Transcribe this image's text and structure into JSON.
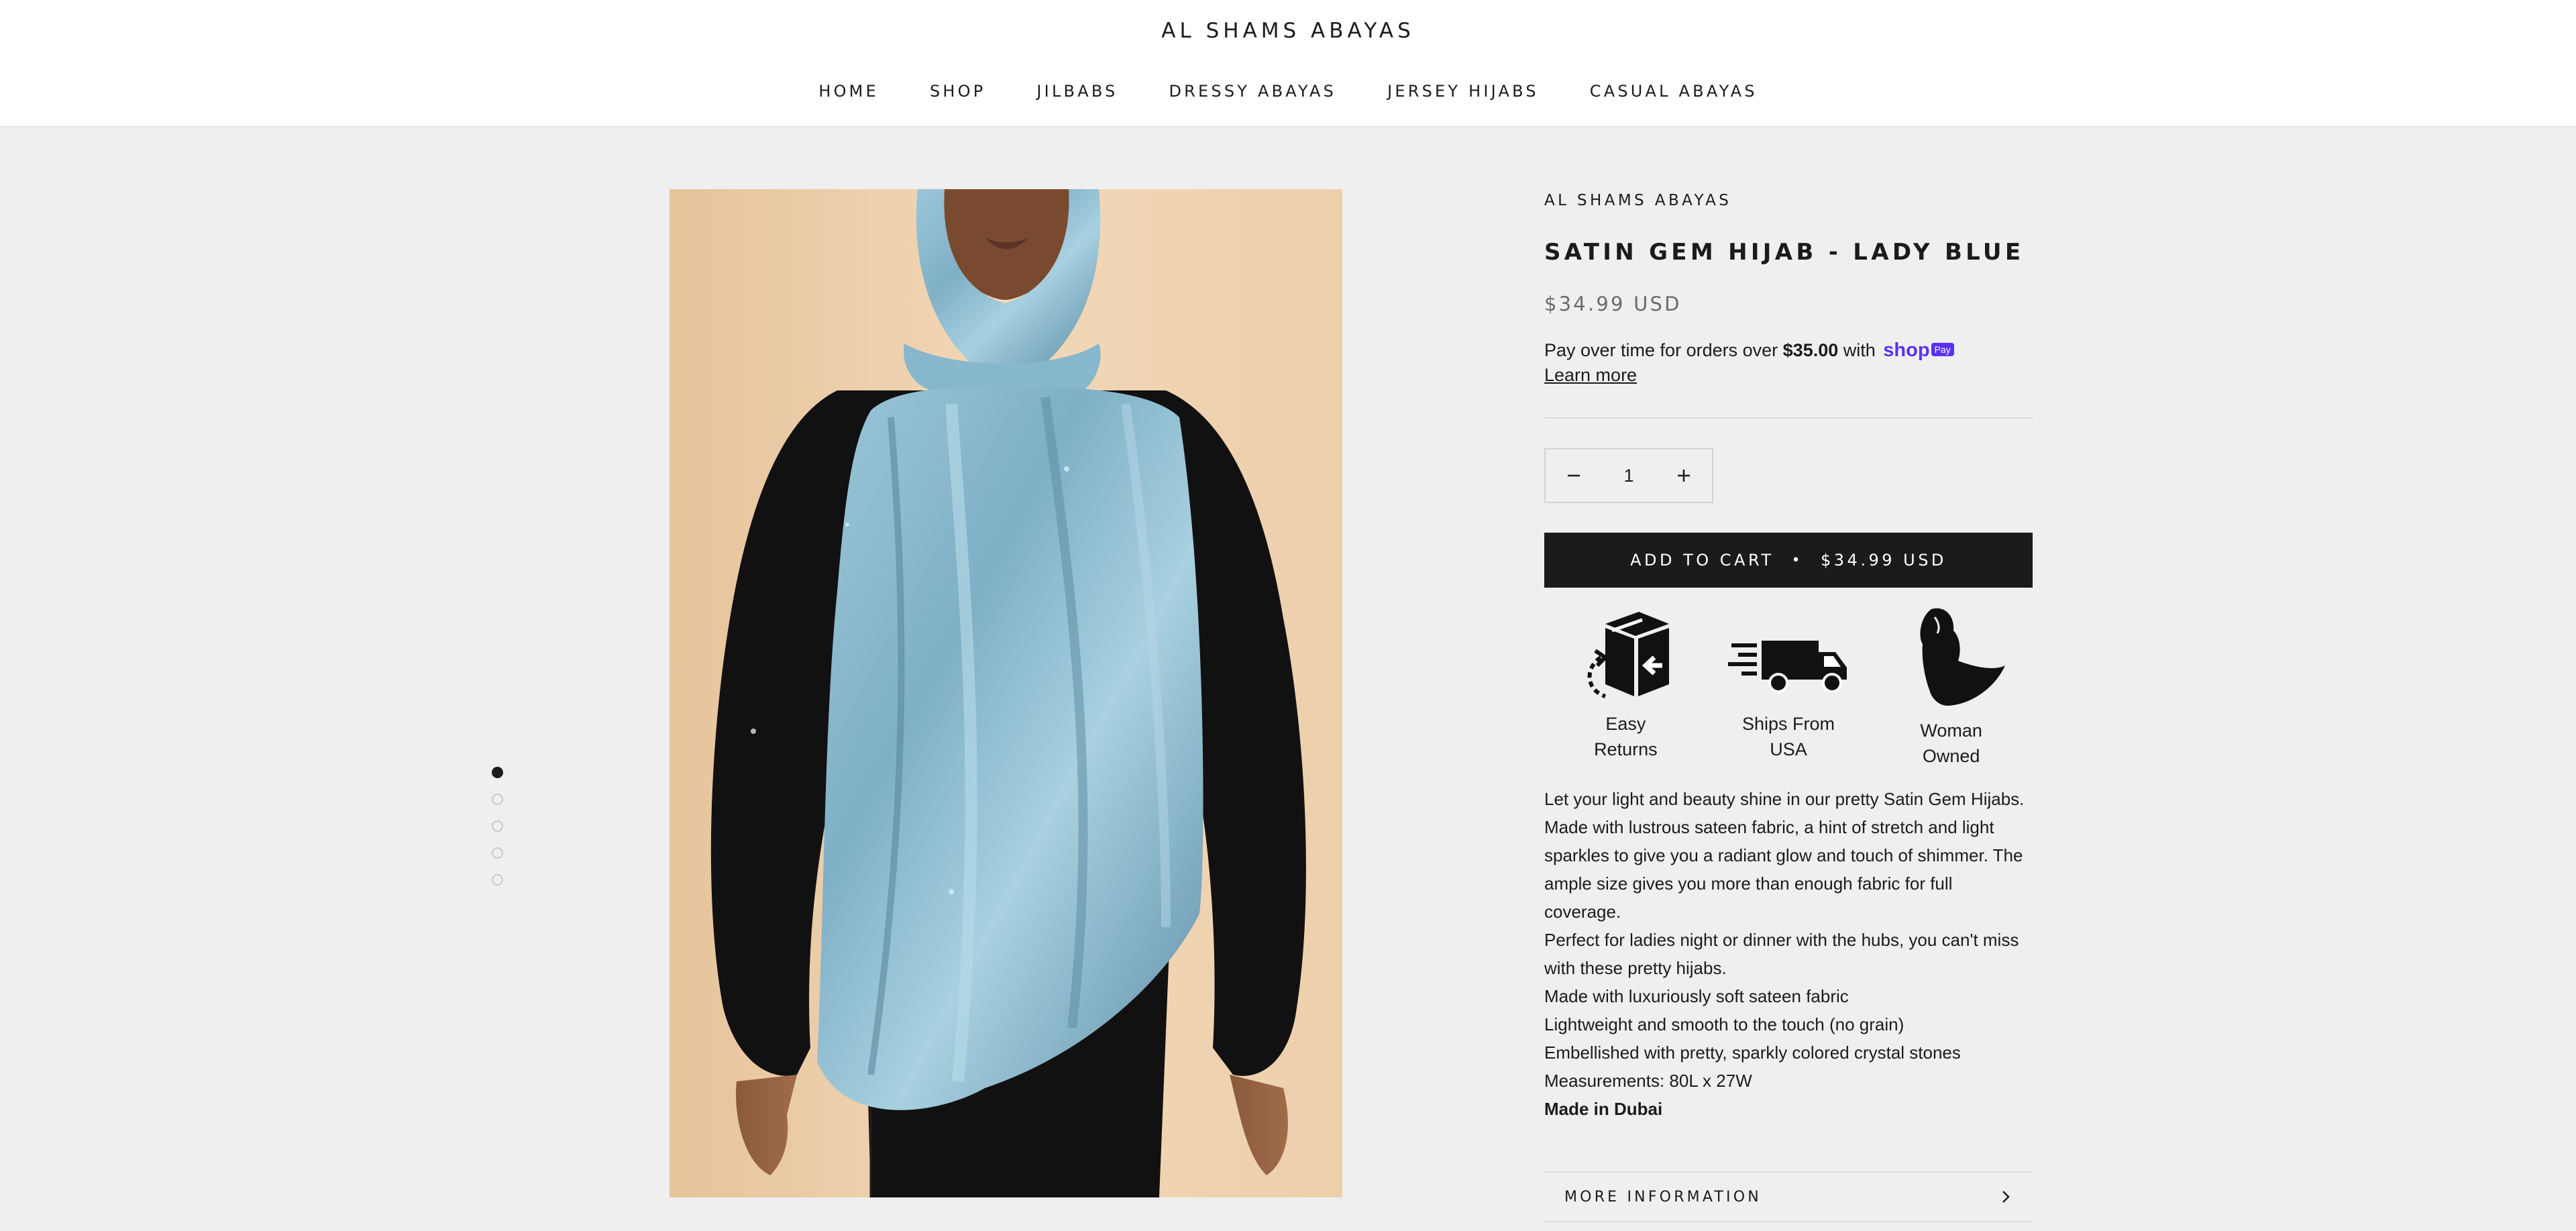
{
  "header": {
    "logo": "AL SHAMS ABAYAS",
    "nav": [
      "HOME",
      "SHOP",
      "JILBABS",
      "DRESSY ABAYAS",
      "JERSEY HIJABS",
      "CASUAL ABAYAS"
    ]
  },
  "gallery": {
    "slide_count": 5,
    "active_slide": 1,
    "image_icon": "product-photo-hijab"
  },
  "product": {
    "vendor": "AL SHAMS ABAYAS",
    "title": "SATIN GEM HIJAB - LADY BLUE",
    "price": "$34.99 USD",
    "shoppay": {
      "prefix": "Pay over time for orders over",
      "amount": "$35.00",
      "suffix": "with",
      "brand": "shop",
      "badge": "Pay",
      "learn_more": "Learn more"
    },
    "quantity": {
      "value": "1",
      "minus_icon": "minus-icon",
      "plus_icon": "plus-icon"
    },
    "add_to_cart": {
      "label": "ADD TO CART",
      "separator": "•",
      "price": "$34.99 USD"
    },
    "badges": [
      {
        "icon": "box-return-icon",
        "line1": "Easy",
        "line2": "Returns"
      },
      {
        "icon": "delivery-truck-icon",
        "line1": "Ships From",
        "line2": "USA"
      },
      {
        "icon": "woman-hijab-icon",
        "line1": "Woman",
        "line2": "Owned"
      }
    ],
    "description": {
      "line1": "Let your light and beauty shine in our pretty Satin Gem Hijabs.",
      "line2": "Made with lustrous sateen fabric, a hint of stretch and light",
      "line3": "sparkles to give you a radiant glow and touch of shimmer. The",
      "line4": "ample size gives you more than enough fabric for full coverage.",
      "line5": "Perfect for ladies night or dinner with the hubs, you can't miss",
      "line6": "with these pretty hijabs."
    },
    "features": [
      "Made with luxuriously soft sateen fabric",
      "Lightweight and smooth to the touch (no grain)",
      "Embellished with pretty, sparkly colored crystal stones",
      "Measurements: 80L x 27W"
    ],
    "origin": "Made in Dubai",
    "more_info": {
      "label": "MORE INFORMATION",
      "icon": "chevron-right-icon"
    }
  },
  "colors": {
    "background": "#efefef",
    "header": "#ffffff",
    "text": "#1c1b1b",
    "price": "#6b6b6b",
    "button": "#1c1b1b",
    "shop_pay": "#5a31f4",
    "hijab": "#7fb0c6"
  }
}
